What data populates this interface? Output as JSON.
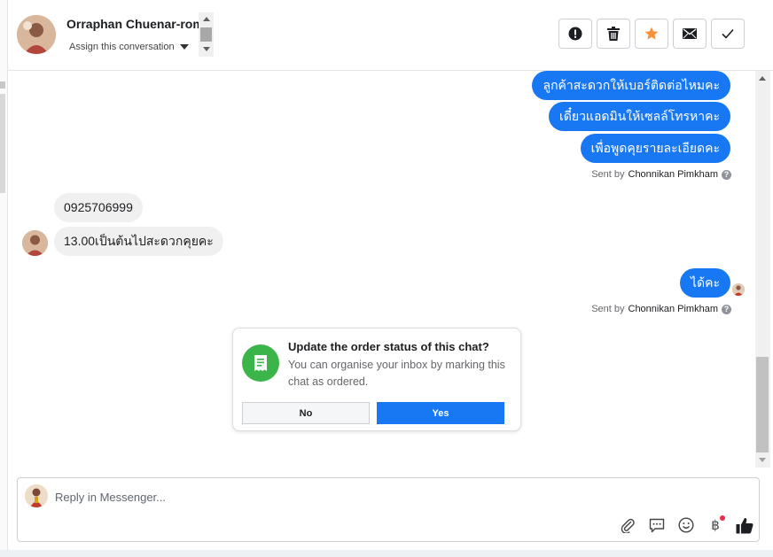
{
  "header": {
    "contact_name": "Orraphan Chuenar-rom",
    "assign_label": "Assign this conversation",
    "tools": [
      {
        "name": "spam-button",
        "icon": "exclamation-icon"
      },
      {
        "name": "delete-button",
        "icon": "trash-icon"
      },
      {
        "name": "star-button",
        "icon": "star-icon",
        "color": "#f7923a"
      },
      {
        "name": "mark-unread-button",
        "icon": "envelope-icon"
      },
      {
        "name": "mark-done-button",
        "icon": "check-icon"
      }
    ]
  },
  "messages": {
    "outgoing_1": [
      "ลูกค้าสะดวกให้เบอร์ติดต่อไหมคะ",
      "เดี๋ยวแอดมินให้เซลล์โทรหาคะ",
      "เพื่อพูดคุยรายละเอียดคะ"
    ],
    "sent_by_1": {
      "prefix": "Sent by",
      "name": "Chonnikan Pimkham"
    },
    "incoming": [
      "0925706999",
      "13.00เป็นต้นไปสะดวกคุยคะ"
    ],
    "outgoing_2": [
      "ได้คะ"
    ],
    "sent_by_2": {
      "prefix": "Sent by",
      "name": "Chonnikan Pimkham"
    },
    "help_mark": "?"
  },
  "order_prompt": {
    "title": "Update the order status of this chat?",
    "text": "You can organise your inbox by marking this chat as ordered.",
    "no_label": "No",
    "yes_label": "Yes",
    "icon": "receipt-icon",
    "icon_color": "#3bb54a"
  },
  "composer": {
    "placeholder": "Reply in Messenger...",
    "tools": [
      "attachment-icon",
      "saved-reply-icon",
      "emoji-icon",
      "baht-payment-icon",
      "like-icon"
    ],
    "baht_symbol": "฿"
  },
  "colors": {
    "accent": "#1877f2",
    "notification": "#f02849"
  }
}
